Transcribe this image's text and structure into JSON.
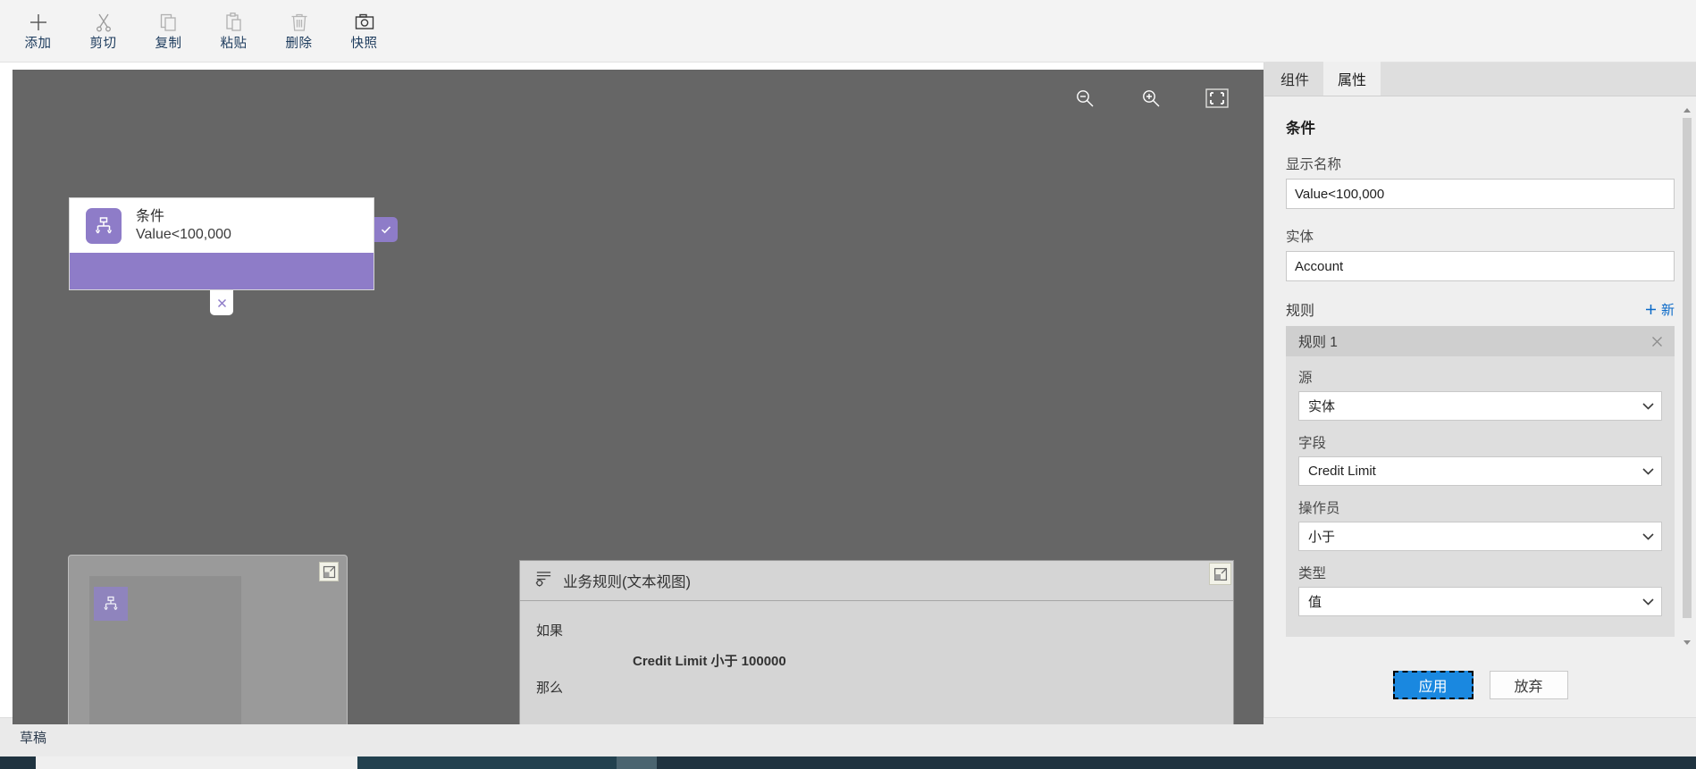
{
  "toolbar": {
    "items": [
      {
        "label": "添加",
        "icon": "plus-icon"
      },
      {
        "label": "剪切",
        "icon": "scissors-icon"
      },
      {
        "label": "复制",
        "icon": "copy-icon"
      },
      {
        "label": "粘贴",
        "icon": "clipboard-icon"
      },
      {
        "label": "删除",
        "icon": "trash-icon"
      },
      {
        "label": "快照",
        "icon": "camera-icon"
      }
    ]
  },
  "canvas": {
    "zoom_controls": [
      {
        "name": "zoom-out-icon"
      },
      {
        "name": "zoom-in-icon"
      },
      {
        "name": "fit-to-screen-icon"
      }
    ],
    "node": {
      "icon": "condition-node-icon",
      "title": "条件",
      "subtitle": "Value<100,000",
      "accept_icon": "check-icon",
      "close_icon": "close-icon"
    },
    "minimap": {
      "expand_icon": "expand-icon",
      "node_icon": "condition-node-icon"
    },
    "business_rule_panel": {
      "icon": "business-rule-icon",
      "title": "业务规则(文本视图)",
      "expand_icon": "expand-icon",
      "if_label": "如果",
      "expression": "Credit Limit 小于 100000",
      "then_label": "那么"
    }
  },
  "properties": {
    "tabs": [
      {
        "label": "组件",
        "active": false
      },
      {
        "label": "属性",
        "active": true
      }
    ],
    "heading": "条件",
    "fields": [
      {
        "label": "显示名称",
        "value": "Value<100,000"
      },
      {
        "label": "实体",
        "value": "Account"
      }
    ],
    "rules_section": {
      "title": "规则",
      "new_label": "新",
      "new_icon": "plus-icon",
      "rule": {
        "title": "规则 1",
        "close_icon": "close-icon",
        "selects": [
          {
            "label": "源",
            "value": "实体"
          },
          {
            "label": "字段",
            "value": "Credit Limit"
          },
          {
            "label": "操作员",
            "value": "小于"
          },
          {
            "label": "类型",
            "value": "值"
          }
        ]
      }
    },
    "footer": {
      "apply_label": "应用",
      "discard_label": "放弃"
    }
  },
  "statusbar": {
    "text": "草稿"
  },
  "colors": {
    "accent_purple": "#8e7cc8",
    "apply_blue": "#1a88e0",
    "link_blue": "#0b6ac8",
    "canvas_gray": "#666666"
  }
}
